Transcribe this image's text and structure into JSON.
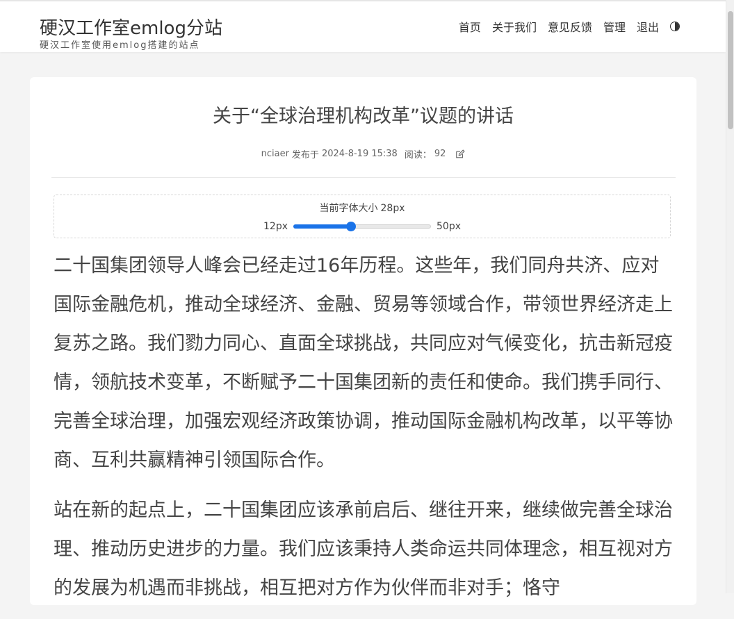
{
  "header": {
    "site_title": "硬汉工作室emlog分站",
    "site_subtitle": "硬汉工作室使用emlog搭建的站点",
    "nav": [
      {
        "label": "首页"
      },
      {
        "label": "关于我们"
      },
      {
        "label": "意见反馈"
      },
      {
        "label": "管理"
      },
      {
        "label": "退出"
      }
    ],
    "theme_toggle_icon": "half-circle-icon"
  },
  "post": {
    "title": "关于“全球治理机构改革”议题的讲话",
    "author": "nciaer",
    "published_label": "发布于",
    "date": "2024-8-19 15:38",
    "views_label": "阅读：",
    "views": "92",
    "edit_icon": "edit-icon"
  },
  "font_control": {
    "label": "当前字体大小",
    "current": "28px",
    "min_label": "12px",
    "max_label": "50px",
    "min": 12,
    "max": 50,
    "value": 28
  },
  "colors": {
    "accent": "#1a73e8",
    "background": "#f4f4f4"
  },
  "article": {
    "paragraphs": [
      "二十国集团领导人峰会已经走过16年历程。这些年，我们同舟共济、应对国际金融危机，推动全球经济、金融、贸易等领域合作，带领世界经济走上复苏之路。我们勠力同心、直面全球挑战，共同应对气候变化，抗击新冠疫情，领航技术变革，不断赋予二十国集团新的责任和使命。我们携手同行、完善全球治理，加强宏观经济政策协调，推动国际金融机构改革，以平等协商、互利共赢精神引领国际合作。",
      "站在新的起点上，二十国集团应该承前启后、继往开来，继续做完善全球治理、推动历史进步的力量。我们应该秉持人类命运共同体理念，相互视对方的发展为机遇而非挑战，相互把对方作为伙伴而非对手；恪守"
    ]
  }
}
